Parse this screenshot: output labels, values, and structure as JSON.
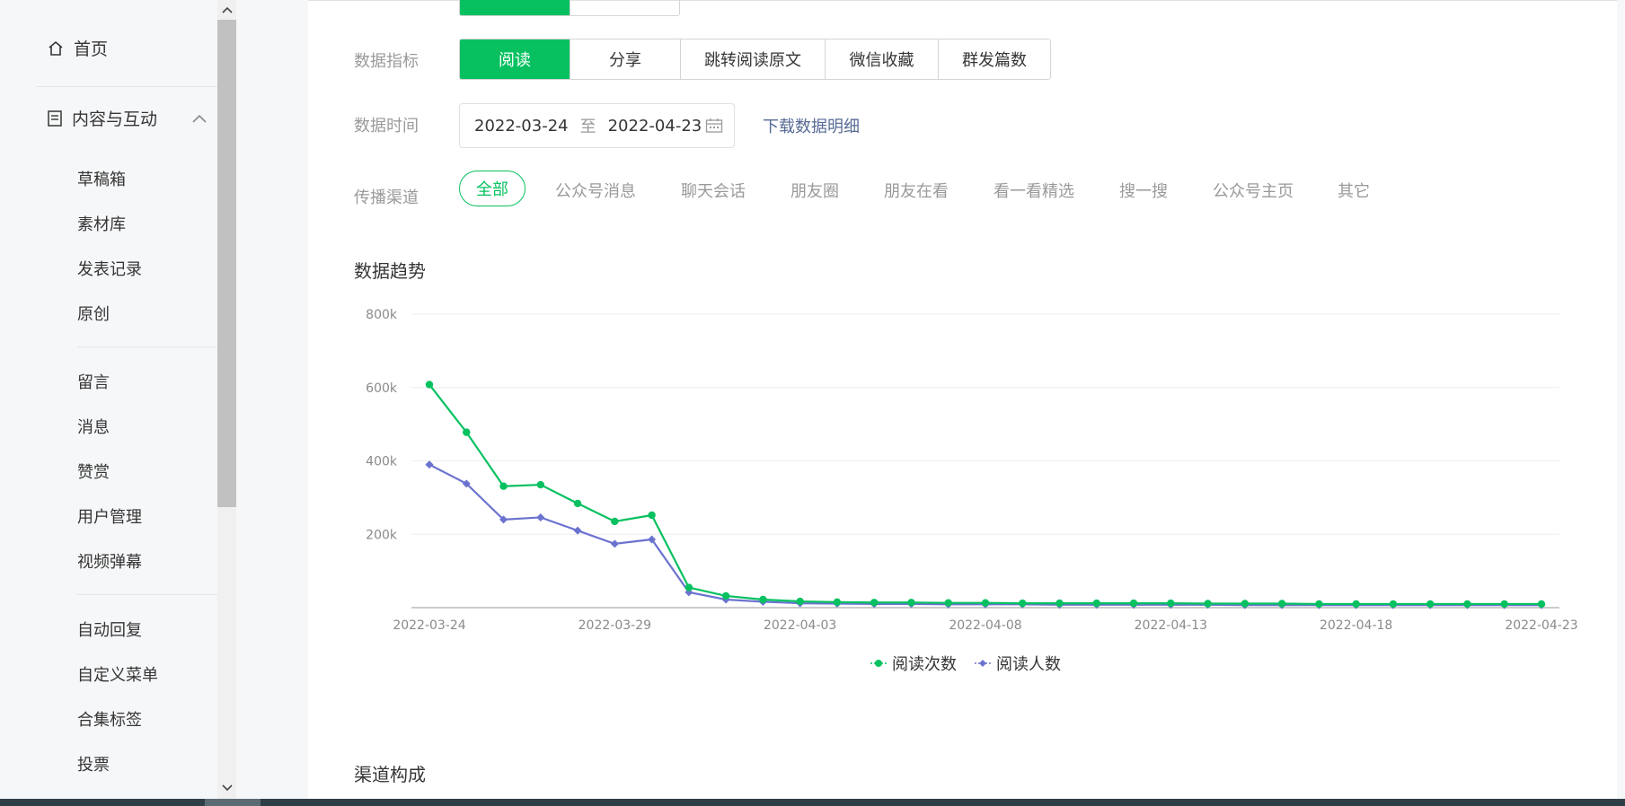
{
  "sidebar": {
    "home": {
      "label": "首页",
      "icon": "home-icon"
    },
    "group": {
      "label": "内容与互动",
      "icon": "document-icon",
      "expanded": true
    },
    "sub_items_1": [
      "草稿箱",
      "素材库",
      "发表记录",
      "原创"
    ],
    "sub_items_2": [
      "留言",
      "消息",
      "赞赏",
      "用户管理",
      "视频弹幕"
    ],
    "sub_items_3": [
      "自动回复",
      "自定义菜单",
      "合集标签",
      "投票"
    ]
  },
  "filters": {
    "top_segment": [
      "",
      ""
    ],
    "metric_label": "数据指标",
    "metrics": [
      "阅读",
      "分享",
      "跳转阅读原文",
      "微信收藏",
      "群发篇数"
    ],
    "active_metric": "阅读",
    "time_label": "数据时间",
    "date_start": "2022-03-24",
    "date_sep": "至",
    "date_end": "2022-04-23",
    "download_link": "下载数据明细",
    "channel_label": "传播渠道",
    "channels": [
      "全部",
      "公众号消息",
      "聊天会话",
      "朋友圈",
      "朋友在看",
      "看一看精选",
      "搜一搜",
      "公众号主页",
      "其它"
    ]
  },
  "trend_title": "数据趋势",
  "composition_title": "渠道构成",
  "colors": {
    "accent": "#07c160",
    "series1": "#07c160",
    "series2": "#6b73cf",
    "link": "#576b95"
  },
  "chart_data": {
    "type": "line",
    "x": [
      "2022-03-24",
      "2022-03-25",
      "2022-03-26",
      "2022-03-27",
      "2022-03-28",
      "2022-03-29",
      "2022-03-30",
      "2022-03-31",
      "2022-04-01",
      "2022-04-02",
      "2022-04-03",
      "2022-04-04",
      "2022-04-05",
      "2022-04-06",
      "2022-04-07",
      "2022-04-08",
      "2022-04-09",
      "2022-04-10",
      "2022-04-11",
      "2022-04-12",
      "2022-04-13",
      "2022-04-14",
      "2022-04-15",
      "2022-04-16",
      "2022-04-17",
      "2022-04-18",
      "2022-04-19",
      "2022-04-20",
      "2022-04-21",
      "2022-04-22",
      "2022-04-23"
    ],
    "x_tick_labels": [
      "2022-03-24",
      "2022-03-29",
      "2022-04-03",
      "2022-04-08",
      "2022-04-13",
      "2022-04-18",
      "2022-04-23"
    ],
    "y_tick_labels": [
      "800k",
      "600k",
      "400k",
      "200k"
    ],
    "ylim": [
      0,
      800000
    ],
    "series": [
      {
        "name": "阅读次数",
        "values": [
          608000,
          478000,
          331000,
          335000,
          284000,
          235000,
          252000,
          55000,
          32000,
          22000,
          17000,
          15000,
          14000,
          14000,
          13000,
          13000,
          12000,
          12000,
          12000,
          12000,
          12000,
          11000,
          11000,
          11000,
          10000,
          10000,
          10000,
          10000,
          10000,
          10000,
          10000
        ]
      },
      {
        "name": "阅读人数",
        "values": [
          390000,
          338000,
          240000,
          246000,
          210000,
          174000,
          186000,
          42000,
          22000,
          16000,
          12000,
          11000,
          10000,
          10000,
          9000,
          9000,
          9000,
          8000,
          8000,
          8000,
          8000,
          8000,
          7000,
          7000,
          7000,
          7000,
          7000,
          7000,
          7000,
          7000,
          7000
        ]
      }
    ],
    "grid": true,
    "legend": "bottom-center"
  }
}
